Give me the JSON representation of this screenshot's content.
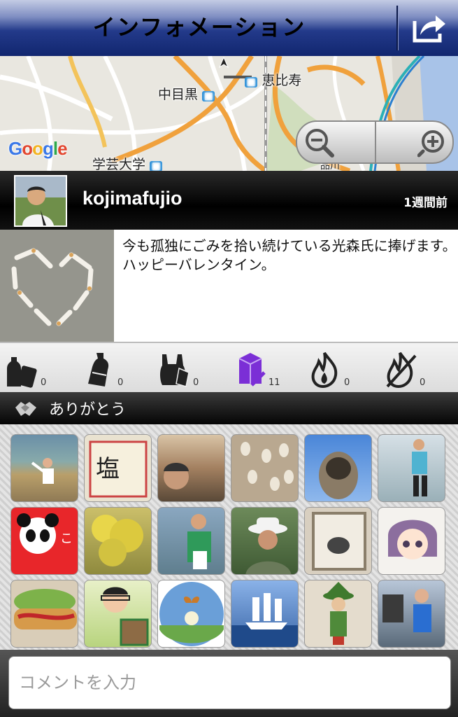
{
  "nav": {
    "title": "インフォメーション",
    "share_icon": "share-icon"
  },
  "map": {
    "labels": {
      "ebisu": "恵比寿",
      "nakameguro": "中目黒",
      "gakugeidaigaku": "学芸大学",
      "clipped": "品川"
    },
    "logo": "Google",
    "zoom_out_icon": "zoom-out-icon",
    "zoom_in_icon": "zoom-in-icon"
  },
  "user": {
    "name": "kojimafujio",
    "time": "1週間前"
  },
  "post": {
    "text": "今も孤独にごみを拾い続けている光森氏に捧げます。ハッピーバレンタイン。"
  },
  "stats": [
    {
      "icon": "can-bottle-icon",
      "count": "0",
      "color": "#222222"
    },
    {
      "icon": "plastic-bottle-icon",
      "count": "0",
      "color": "#222222"
    },
    {
      "icon": "plastic-bag-icon",
      "count": "0",
      "color": "#222222"
    },
    {
      "icon": "paper-carton-icon",
      "count": "11",
      "color": "#7b2fd6"
    },
    {
      "icon": "burnable-icon",
      "count": "0",
      "color": "#222222"
    },
    {
      "icon": "non-burnable-icon",
      "count": "0",
      "color": "#222222"
    }
  ],
  "thanks": {
    "label": "ありがとう",
    "icon": "handshake-icon"
  },
  "thanked_users": [
    "baseball-player",
    "salt-package",
    "selfie-cap",
    "pussy-willow",
    "pug-dog",
    "runner",
    "panda-kokoro",
    "yellow-tree",
    "volunteer-vest",
    "man-white-hat",
    "framed-painting",
    "anime-girl",
    "burger",
    "cartoon-man-dog",
    "butterfly-flower",
    "sailing-ship",
    "gnome-figure",
    "festival-cosplay"
  ],
  "comment": {
    "placeholder": "コメントを入力"
  }
}
